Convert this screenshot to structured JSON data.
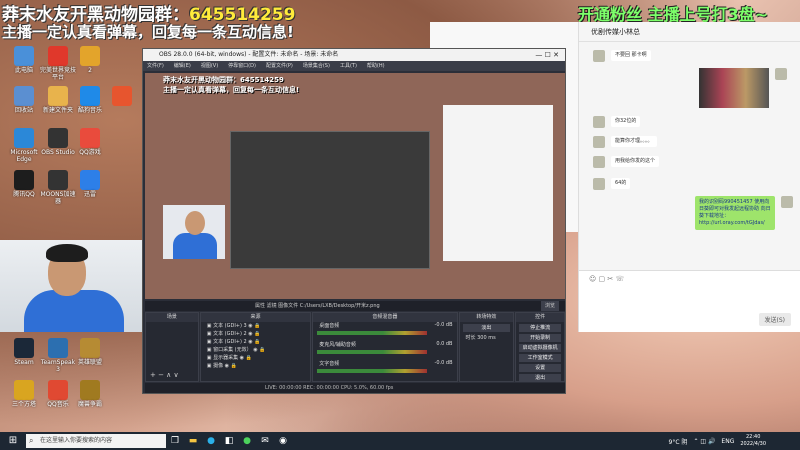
{
  "overlay": {
    "line1_prefix": "莽末水友开黑动物园群：",
    "line1_number": "645514259",
    "line2": "主播一定认真看弹幕，回复每一条互动信息!",
    "right_banner": "开通粉丝   主播上号打3盘~"
  },
  "desktop_icons": [
    {
      "label": "此电脑",
      "color": "#4a90d9"
    },
    {
      "label": "完美世界竞技平台",
      "color": "#e0382b"
    },
    {
      "label": "2",
      "color": "#e3a42b"
    },
    {
      "label": "回收站",
      "color": "#5b8fd1"
    },
    {
      "label": "新建文件夹",
      "color": "#e8b34c"
    },
    {
      "label": "酷狗音乐",
      "color": "#1f8ae8"
    },
    {
      "label": "",
      "color": "#e7552e"
    },
    {
      "label": "Microsoft Edge",
      "color": "#2b88d8"
    },
    {
      "label": "OBS Studio",
      "color": "#333"
    },
    {
      "label": "QQ游戏",
      "color": "#e94b3c"
    },
    {
      "label": "腾讯QQ",
      "color": "#1d1d1d"
    },
    {
      "label": "MOONS加速器",
      "color": "#333"
    },
    {
      "label": "迅雷",
      "color": "#2d7fe8"
    },
    {
      "label": "Steam",
      "color": "#1b2838"
    },
    {
      "label": "TeamSpeak 3",
      "color": "#2c6fb0"
    },
    {
      "label": "英雄联盟",
      "color": "#b68b33"
    },
    {
      "label": "三个方塔",
      "color": "#d9a520"
    },
    {
      "label": "QQ音乐",
      "color": "#e04932"
    },
    {
      "label": "魔兽争霸",
      "color": "#a07a20"
    }
  ],
  "obs": {
    "title": "OBS 28.0.0 (64-bit, windows) - 配置文件: 未命名 - 场景: 未命名",
    "menu": [
      "文件(F)",
      "编辑(E)",
      "视图(V)",
      "停靠窗口(D)",
      "配置文件(P)",
      "场景集合(S)",
      "工具(T)",
      "帮助(H)"
    ],
    "source_bar": "属性  滤镜  图像文件  C:/Users/LXB/Desktop/开米z.png",
    "source_bar_btn": "浏览",
    "docks": {
      "scenes": "场景",
      "sources": "来源",
      "mixer": "音频混音器",
      "transitions": "转场特效",
      "controls": "控件"
    },
    "sources": [
      "文本 (GDI+) 3",
      "文本 (GDI+) 2",
      "文本 (GDI+) 2",
      "窗口采集 (无效）",
      "显示器采集",
      "摄像"
    ],
    "mixer": [
      {
        "name": "桌面音频",
        "db": "-0.0 dB"
      },
      {
        "name": "麦克风/辅助音频",
        "db": "0.0 dB"
      },
      {
        "name": "文字音频",
        "db": "-0.0 dB"
      }
    ],
    "transition": "淡出",
    "duration_label": "时长",
    "duration": "300 ms",
    "controls": [
      "停止推流",
      "开始录制",
      "启动虚拟摄像机",
      "工作室模式",
      "设置",
      "退出"
    ],
    "status": "LIVE: 00:00:00   REC: 00:00:00   CPU: 5.0%, 60.00 fps"
  },
  "chat": {
    "header": "优剧传媒小林总",
    "messages": [
      "不要回 那卡啊",
      "你32位的",
      "能算你才理。。。。",
      "用我给你发的这个",
      "64的"
    ],
    "green": "我的识别码990451457 使用向日葵即可对我发起远程协助 向日葵下载地址：http://url.oray.com/tGJdas/",
    "send": "发送(S)"
  },
  "taskbar": {
    "search": "在这里输入你要搜索的内容",
    "weather": "9°C 阴",
    "lang": "ENG",
    "time": "22:40",
    "date": "2022/4/30"
  }
}
